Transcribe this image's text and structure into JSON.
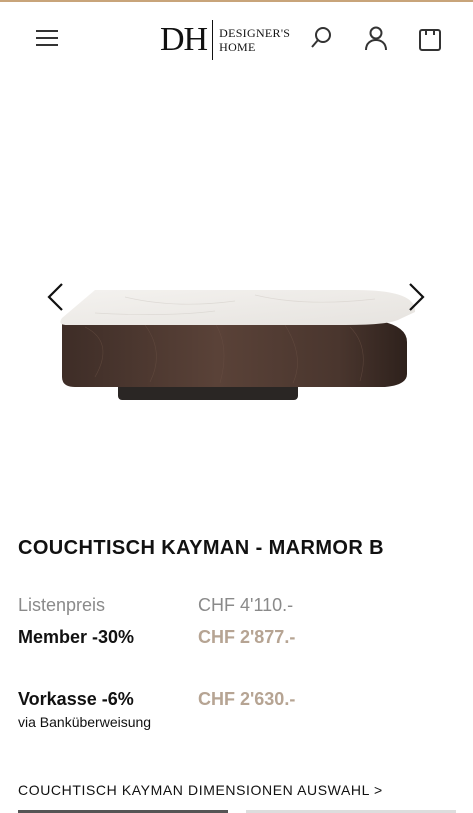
{
  "header": {
    "logo_mark": "DH",
    "logo_line1": "DESIGNER'S",
    "logo_line2": "HOME"
  },
  "product": {
    "title": "COUCHTISCH KAYMAN - MARMOR B",
    "list_price_label": "Listenpreis",
    "list_price": "CHF 4'110.-",
    "member_label": "Member -30%",
    "member_price": "CHF 2'877.-",
    "prepay_label": "Vorkasse -6%",
    "prepay_price": "CHF 2'630.-",
    "prepay_note": "via Banküberweisung"
  },
  "links": {
    "dimensions": "COUCHTISCH KAYMAN DIMENSIONEN AUSWAHL >"
  },
  "icons": {
    "menu": "hamburger-menu-icon",
    "search": "search-icon",
    "account": "user-icon",
    "cart": "shopping-bag-icon",
    "prev": "chevron-left-icon",
    "next": "chevron-right-icon"
  },
  "colors": {
    "accent": "#c8a47a",
    "discount_price": "#b6a493",
    "list_price": "#8a8a8a"
  }
}
